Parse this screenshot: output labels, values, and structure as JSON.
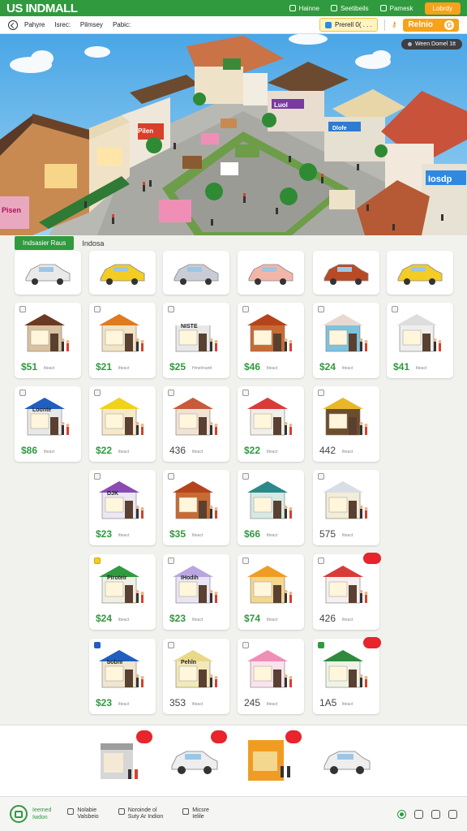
{
  "app": {
    "brand": "US INDMALL"
  },
  "topbar": {
    "items": [
      {
        "label": "Hainne",
        "icon": "phone-icon"
      },
      {
        "label": "Seetibeils",
        "icon": "gift-icon"
      },
      {
        "label": "Pamesk",
        "icon": "person-icon"
      }
    ],
    "action_label": "Lobrdy"
  },
  "navbar": {
    "links": [
      "Pahyre",
      "Isrec:",
      "Pilmsey",
      "Pabic:"
    ],
    "location": "Prerell 0( . . .",
    "coins_label": "Relnio"
  },
  "scene": {
    "badge": "Ween Domel 1tt",
    "signs": [
      "Pisen",
      "Pilen",
      "Dlofe",
      "Iosdp",
      "Luol"
    ]
  },
  "section": {
    "active_tab": "Indsasier Raus",
    "label": "Indosa"
  },
  "cars": [
    {
      "color": "#e9e9e9"
    },
    {
      "color": "#f3cc24"
    },
    {
      "color": "#c9ccd6"
    },
    {
      "color": "#f1b6a8"
    },
    {
      "color": "#b84a25"
    },
    {
      "color": "#f3cc24"
    }
  ],
  "shops": [
    {
      "price": "$51",
      "unit": "ltteact",
      "roof": "#6b3a22",
      "wall": "#d9c2a0"
    },
    {
      "price": "$21",
      "unit": "ltteact",
      "roof": "#e07a1e",
      "wall": "#f1e3c4"
    },
    {
      "price": "$25",
      "unit": "Hmelmantt",
      "roof": "#ffffff",
      "wall": "#e8e8e8",
      "sign": "NISTE"
    },
    {
      "price": "$46",
      "unit": "ltteact",
      "roof": "#b5441c",
      "wall": "#c96a32"
    },
    {
      "price": "$24",
      "unit": "ltteact",
      "roof": "#e8d9d0",
      "wall": "#7dc3de"
    },
    {
      "price": "$41",
      "unit": "ltteact",
      "roof": "#dddddd",
      "wall": "#eeeeee"
    },
    {
      "price": "$86",
      "unit": "ltteact",
      "roof": "#1f5fbf",
      "wall": "#e8e8e8",
      "sign": "Loonte"
    },
    {
      "price": "$22",
      "unit": "ltteact",
      "roof": "#f0d21a",
      "wall": "#f7e9c8"
    },
    {
      "price": "436",
      "unit": "ltteact",
      "roof": "#c75a3b",
      "wall": "#f1e2d4"
    },
    {
      "price": "$22",
      "unit": "ltteact",
      "roof": "#d93b3b",
      "wall": "#f1efe8"
    },
    {
      "price": "442",
      "unit": "ltteact",
      "roof": "#e8b82a",
      "wall": "#6e4e2a"
    },
    {
      "price": "$23",
      "unit": "ltteact",
      "roof": "#8b4bb3",
      "wall": "#ece7f2",
      "sign": "DJK"
    },
    {
      "price": "$35",
      "unit": "ltteact",
      "roof": "#b5441c",
      "wall": "#c96a32"
    },
    {
      "price": "$66",
      "unit": "ltteact",
      "roof": "#2a8a8a",
      "wall": "#d6e9e4"
    },
    {
      "price": "575",
      "unit": "ltteact",
      "roof": "#d8dde6",
      "wall": "#f3ecd8"
    },
    {
      "price": "$24",
      "unit": "ltteact",
      "roof": "#2f9a3e",
      "wall": "#eef0e2",
      "sign": "Piroteir"
    },
    {
      "price": "$23",
      "unit": "ltteact",
      "roof": "#b9a6e0",
      "wall": "#e9e5f2",
      "sign": "IHodih"
    },
    {
      "price": "$74",
      "unit": "ltteact",
      "roof": "#f09c22",
      "wall": "#f4d78e"
    },
    {
      "price": "426",
      "unit": "ltteact",
      "roof": "#d93b3b",
      "wall": "#f6f0f0"
    },
    {
      "price": "$23",
      "unit": "ltteact",
      "roof": "#1f5fbf",
      "wall": "#f0e6d0",
      "sign": "bobnr"
    },
    {
      "price": "353",
      "unit": "ltteact",
      "roof": "#e9d88a",
      "wall": "#f3e9b8",
      "sign": "Pehln"
    },
    {
      "price": "245",
      "unit": "ltteact",
      "roof": "#f08fb6",
      "wall": "#fbe3ee"
    },
    {
      "price": "1A5",
      "unit": "ltteact",
      "roof": "#2f8a3e",
      "wall": "#eef3e6"
    }
  ],
  "tray": {
    "items": [
      "shop",
      "car",
      "shop",
      "car"
    ]
  },
  "footer": {
    "title_line1": "Ieemed",
    "title_line2": "Iwdon",
    "groups": [
      {
        "l1": "Nolabie",
        "l2": "Valsbeio"
      },
      {
        "l1": "Noroinde ol",
        "l2": "Suty Ar Indion"
      },
      {
        "l1": "Micsre",
        "l2": "Ielile"
      }
    ]
  },
  "colors": {
    "accent": "#2f9a3e",
    "orange": "#f6a21a",
    "red": "#e8242c"
  }
}
